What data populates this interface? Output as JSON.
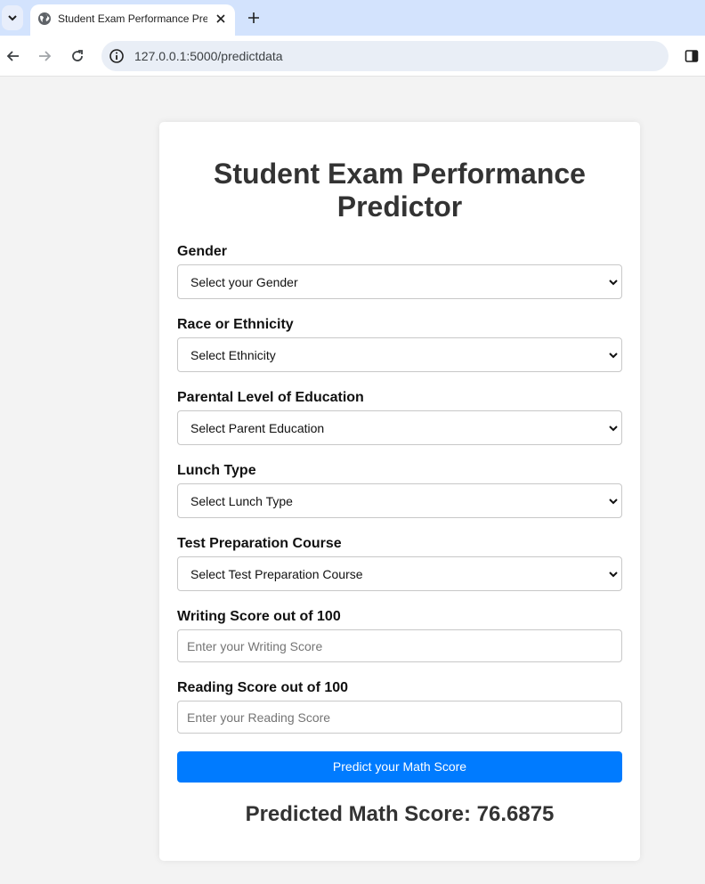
{
  "browser": {
    "tab_title": "Student Exam Performance Predictor",
    "url": "127.0.0.1:5000/predictdata"
  },
  "page": {
    "title": "Student Exam Performance Predictor",
    "fields": [
      {
        "label": "Gender",
        "type": "select",
        "value": "Select your Gender"
      },
      {
        "label": "Race or Ethnicity",
        "type": "select",
        "value": "Select Ethnicity"
      },
      {
        "label": "Parental Level of Education",
        "type": "select",
        "value": "Select Parent Education"
      },
      {
        "label": "Lunch Type",
        "type": "select",
        "value": "Select Lunch Type"
      },
      {
        "label": "Test Preparation Course",
        "type": "select",
        "value": "Select Test Preparation Course"
      },
      {
        "label": "Writing Score out of 100",
        "type": "input",
        "value": "",
        "placeholder": "Enter your Writing Score"
      },
      {
        "label": "Reading Score out of 100",
        "type": "input",
        "value": "",
        "placeholder": "Enter your Reading Score"
      }
    ],
    "submit_label": "Predict your Math Score",
    "result_text": "Predicted Math Score: 76.6875"
  },
  "colors": {
    "accent": "#007bff",
    "tabbar": "#d3e3fd",
    "page_bg": "#f3f3f3"
  },
  "icons": [
    "tab-list-icon",
    "globe-icon",
    "close-icon",
    "plus-icon",
    "back-arrow-icon",
    "forward-arrow-icon",
    "reload-icon",
    "info-icon",
    "side-panel-icon",
    "chevron-down-icon"
  ]
}
